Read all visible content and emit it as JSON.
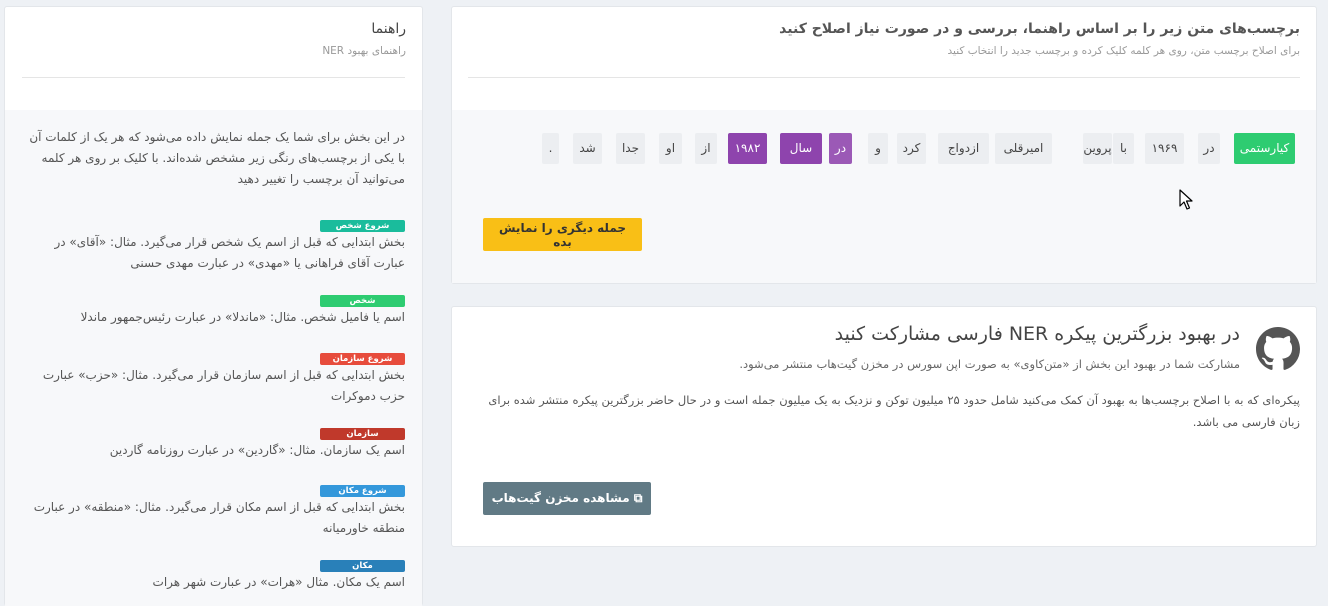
{
  "guide": {
    "title": "راهنما",
    "subtitle": "راهنمای بهبود NER",
    "intro": "در این بخش برای شما یک جمله نمایش داده می‌شود که هر یک از کلمات آن با یکی از برچسب‌های رنگی زیر مشخص شده‌اند. با کلیک بر روی هر کلمه می‌توانید آن برچسب را تغییر دهید",
    "tags": [
      {
        "label": "شروع شخص",
        "color": "#1abc9c",
        "desc": "بخش ابتدایی که قبل از اسم یک شخص قرار می‌گیرد. مثال: «آقای» در عبارت آقای فراهانی یا «مهدی» در عبارت مهدی حسنی"
      },
      {
        "label": "شخص",
        "color": "#2ecc71",
        "desc": "اسم یا فامیل شخص. مثال: «ماندلا» در عبارت رئیس‌جمهور ماندلا"
      },
      {
        "label": "شروع سازمان",
        "color": "#e74c3c",
        "desc": "بخش ابتدایی که قبل از اسم سازمان قرار می‌گیرد. مثال: «حزب» عبارت حزب دموکرات"
      },
      {
        "label": "سازمان",
        "color": "#c0392b",
        "desc": "اسم یک سازمان. مثال: «گاردین» در عبارت روزنامه گاردین"
      },
      {
        "label": "شروع مکان",
        "color": "#3498db",
        "desc": "بخش ابتدایی که قبل از اسم مکان قرار می‌گیرد. مثال: «منطقه» در عبارت منطقه خاورمیانه"
      },
      {
        "label": "مکان",
        "color": "#2980b9",
        "desc": "اسم یک مکان. مثال «هرات» در عبارت شهر هرات"
      }
    ]
  },
  "main": {
    "title": "برچسب‌های متن زیر را بر اساس راهنما، بررسی و در صورت نیاز اصلاح کنید",
    "subtitle": "برای اصلاح برچسب متن، روی هر کلمه کلیک کرده و برچسب جدید را انتخاب کنید",
    "tokens": [
      {
        "text": "کیارستمی",
        "tag": "per"
      },
      {
        "text": "در",
        "tag": "o"
      },
      {
        "text": "۱۹۶۹",
        "tag": "o"
      },
      {
        "text": "با",
        "tag": "o"
      },
      {
        "text": "پروین",
        "tag": "o"
      },
      {
        "text": "امیرقلی",
        "tag": "o"
      },
      {
        "text": "ازدواج",
        "tag": "o"
      },
      {
        "text": "کرد",
        "tag": "o"
      },
      {
        "text": "و",
        "tag": "o"
      },
      {
        "text": "در",
        "tag": "dat-b"
      },
      {
        "text": "سال",
        "tag": "dat"
      },
      {
        "text": "۱۹۸۲",
        "tag": "dat"
      },
      {
        "text": "از",
        "tag": "o"
      },
      {
        "text": "او",
        "tag": "o"
      },
      {
        "text": "جدا",
        "tag": "o"
      },
      {
        "text": "شد",
        "tag": "o"
      },
      {
        "text": ".",
        "tag": "o"
      }
    ],
    "next_button": "جمله دیگری را نمایش بده"
  },
  "contrib": {
    "title": "در بهبود بزرگترین پیکره NER فارسی مشارکت کنید",
    "subtitle": "مشارکت شما در بهبود این بخش از «متن‌کاوی» به صورت اپن سورس در مخزن گیت‌هاب منتشر می‌شود.",
    "body": "پیکره‌ای که به با اصلاح برچسب‌ها به بهبود آن کمک می‌کنید شامل حدود ۲۵ میلیون توکن و نزدیک به یک میلیون جمله است و در حال حاضر بزرگترین پیکره منتشر شده برای زبان فارسی می باشد.",
    "github_button": "مشاهده مخزن گیت‌هاب"
  }
}
